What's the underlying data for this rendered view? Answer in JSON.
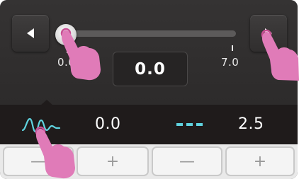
{
  "slider": {
    "min_label": "0.0",
    "max_label": "7.0",
    "value": "0.0",
    "min": 0,
    "max": 7,
    "position": 0
  },
  "nav": {
    "prev_icon": "triangle-left-icon",
    "next_icon": "triangle-right-icon"
  },
  "info": {
    "left_value": "0.0",
    "right_value": "2.5",
    "left_icon": "wave-icon",
    "right_icon": "dashed-line-icon",
    "wave_color": "#5fd3df",
    "dash_color": "#5fd3df"
  },
  "buttons": {
    "b1": "—",
    "b2": "+",
    "b3": "—",
    "b4": "+"
  },
  "colors": {
    "panel": "#2e2c2c",
    "info_bar": "#1f1b1b",
    "touch_hand": "#e07bb8"
  }
}
